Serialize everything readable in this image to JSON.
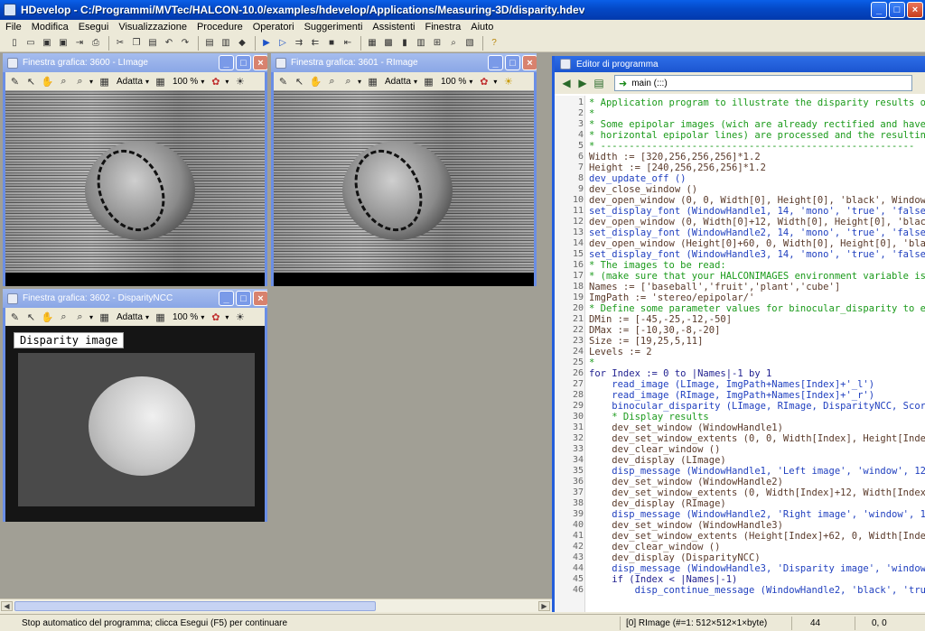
{
  "app": {
    "title": "HDevelop - C:/Programmi/MVTec/HALCON-10.0/examples/hdevelop/Applications/Measuring-3D/disparity.hdev",
    "window_buttons": {
      "minimize": "_",
      "maximize": "□",
      "close": "×"
    }
  },
  "menu": [
    "File",
    "Modifica",
    "Esegui",
    "Visualizzazione",
    "Procedure",
    "Operatori",
    "Suggerimenti",
    "Assistenti",
    "Finestra",
    "Aiuto"
  ],
  "toolbar_icons": [
    "new-file-icon",
    "open-file-icon",
    "save-icon",
    "save-all-icon",
    "export-icon",
    "print-icon",
    "cut-icon",
    "copy-icon",
    "paste-icon",
    "undo-icon",
    "redo-icon",
    "insert-icon",
    "delete-icon",
    "car-icon",
    "run-icon",
    "step-icon",
    "step-over-icon",
    "step-back-icon",
    "stop-icon",
    "reset-icon",
    "graphics-icon",
    "image-icon",
    "histogram-icon",
    "features-icon",
    "measure-icon",
    "zoom-icon",
    "inspect-icon",
    "help-icon"
  ],
  "graphics_windows": [
    {
      "title": "Finestra grafica: 3600 - LImage",
      "fit": "Adatta",
      "zoom": "100 %"
    },
    {
      "title": "Finestra grafica: 3601 - RImage",
      "fit": "Adatta",
      "zoom": "100 %"
    },
    {
      "title": "Finestra grafica: 3602 - DisparityNCC",
      "fit": "Adatta",
      "zoom": "100 %",
      "overlay": "Disparity image"
    }
  ],
  "editor": {
    "title": "Editor di programma",
    "procedure": "main (:::)",
    "lines": [
      {
        "n": "1",
        "t": "* Application program to illustrate the disparity results of",
        "k": "comment"
      },
      {
        "n": "2",
        "t": "*",
        "k": "comment"
      },
      {
        "n": "3",
        "t": "* Some epipolar images (wich are already rectified and have",
        "k": "comment"
      },
      {
        "n": "4",
        "t": "* horizontal epipolar lines) are processed and the resulting",
        "k": "comment"
      },
      {
        "n": "5",
        "t": "* -------------------------------------------------------",
        "k": "comment"
      },
      {
        "n": "6",
        "t": "Width := [320,256,256,256]*1.2",
        "k": "plain"
      },
      {
        "n": "7",
        "t": "Height := [240,256,256,256]*1.2",
        "k": "plain"
      },
      {
        "n": "8",
        "t": "dev_update_off ()",
        "k": "op"
      },
      {
        "n": "9",
        "t": "dev_close_window ()",
        "k": "plain"
      },
      {
        "n": "10",
        "t": "dev_open_window (0, 0, Width[0], Height[0], 'black', WindowH",
        "k": "plain"
      },
      {
        "n": "11",
        "t": "set_display_font (WindowHandle1, 14, 'mono', 'true', 'false'",
        "k": "op"
      },
      {
        "n": "12",
        "t": "dev_open_window (0, Width[0]+12, Width[0], Height[0], 'black",
        "k": "plain"
      },
      {
        "n": "13",
        "t": "set_display_font (WindowHandle2, 14, 'mono', 'true', 'false'",
        "k": "op"
      },
      {
        "n": "14",
        "t": "dev_open_window (Height[0]+60, 0, Width[0], Height[0], 'blac",
        "k": "plain"
      },
      {
        "n": "15",
        "t": "set_display_font (WindowHandle3, 14, 'mono', 'true', 'false'",
        "k": "op"
      },
      {
        "n": "16",
        "t": "* The images to be read:",
        "k": "comment"
      },
      {
        "n": "17",
        "t": "* (make sure that your HALCONIMAGES environment variable is",
        "k": "comment"
      },
      {
        "n": "18",
        "t": "Names := ['baseball','fruit','plant','cube']",
        "k": "plain"
      },
      {
        "n": "19",
        "t": "ImgPath := 'stereo/epipolar/'",
        "k": "plain"
      },
      {
        "n": "20",
        "t": "* Define some parameter values for binocular_disparity to en",
        "k": "comment"
      },
      {
        "n": "21",
        "t": "DMin := [-45,-25,-12,-50]",
        "k": "plain"
      },
      {
        "n": "22",
        "t": "DMax := [-10,30,-8,-20]",
        "k": "plain"
      },
      {
        "n": "23",
        "t": "Size := [19,25,5,11]",
        "k": "plain"
      },
      {
        "n": "24",
        "t": "Levels := 2",
        "k": "plain"
      },
      {
        "n": "25",
        "t": "*",
        "k": "comment"
      },
      {
        "n": "26",
        "t": "for Index := 0 to |Names|-1 by 1",
        "k": "kw"
      },
      {
        "n": "27",
        "t": "    read_image (LImage, ImgPath+Names[Index]+'_l')",
        "k": "op"
      },
      {
        "n": "28",
        "t": "    read_image (RImage, ImgPath+Names[Index]+'_r')",
        "k": "op"
      },
      {
        "n": "29",
        "t": "    binocular_disparity (LImage, RImage, DisparityNCC, Score",
        "k": "op"
      },
      {
        "n": "30",
        "t": "    * Display results",
        "k": "comment"
      },
      {
        "n": "31",
        "t": "    dev_set_window (WindowHandle1)",
        "k": "plain"
      },
      {
        "n": "32",
        "t": "    dev_set_window_extents (0, 0, Width[Index], Height[Index",
        "k": "plain"
      },
      {
        "n": "33",
        "t": "    dev_clear_window ()",
        "k": "plain"
      },
      {
        "n": "34",
        "t": "    dev_display (LImage)",
        "k": "plain"
      },
      {
        "n": "35",
        "t": "    disp_message (WindowHandle1, 'Left image', 'window', 12,",
        "k": "op"
      },
      {
        "n": "36",
        "t": "    dev_set_window (WindowHandle2)",
        "k": "plain"
      },
      {
        "n": "37",
        "t": "    dev_set_window_extents (0, Width[Index]+12, Width[Index]",
        "k": "plain"
      },
      {
        "n": "38",
        "t": "    dev_display (RImage)",
        "k": "plain"
      },
      {
        "n": "39",
        "t": "    disp_message (WindowHandle2, 'Right image', 'window', 12",
        "k": "op"
      },
      {
        "n": "40",
        "t": "    dev_set_window (WindowHandle3)",
        "k": "plain"
      },
      {
        "n": "41",
        "t": "    dev_set_window_extents (Height[Index]+62, 0, Width[Index",
        "k": "plain"
      },
      {
        "n": "42",
        "t": "    dev_clear_window ()",
        "k": "plain"
      },
      {
        "n": "43",
        "t": "    dev_display (DisparityNCC)",
        "k": "plain"
      },
      {
        "n": "44",
        "t": "    disp_message (WindowHandle3, 'Disparity image', 'window'",
        "k": "op"
      },
      {
        "n": "45",
        "t": "    if (Index < |Names|-1)",
        "k": "kw"
      },
      {
        "n": "46",
        "t": "        disp_continue_message (WindowHandle2, 'black', 'true",
        "k": "op"
      }
    ]
  },
  "status": {
    "message": "Stop automatico del programma; clicca Esegui (F5) per continuare",
    "image_info": "[0] RImage (#=1: 512×512×1×byte)",
    "count": "44",
    "coords": "0, 0"
  }
}
